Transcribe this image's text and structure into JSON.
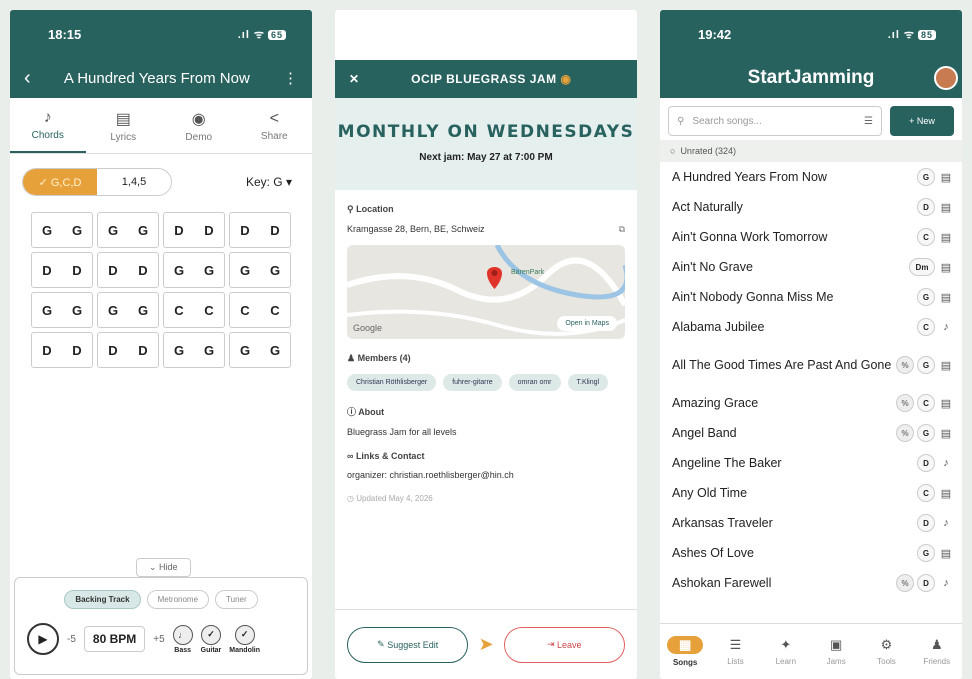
{
  "screen1": {
    "status": {
      "time": "18:15",
      "signal": ".ıl ᯤ",
      "battery": "65"
    },
    "header": {
      "back": "‹",
      "title": "A Hundred Years From Now",
      "menu": "⋮"
    },
    "tabs": [
      {
        "label": "Chords",
        "icon": "♪"
      },
      {
        "label": "Lyrics",
        "icon": "▤"
      },
      {
        "label": "Demo",
        "icon": "◉"
      },
      {
        "label": "Share",
        "icon": "<"
      }
    ],
    "segments": [
      "✓ G,C,D",
      "1,4,5"
    ],
    "key": "Key: G ▾",
    "chord_rows": [
      [
        [
          "G",
          "G"
        ],
        [
          "G",
          "G"
        ],
        [
          "D",
          "D"
        ],
        [
          "D",
          "D"
        ]
      ],
      [
        [
          "D",
          "D"
        ],
        [
          "D",
          "D"
        ],
        [
          "G",
          "G"
        ],
        [
          "G",
          "G"
        ]
      ],
      [
        [
          "G",
          "G"
        ],
        [
          "G",
          "G"
        ],
        [
          "C",
          "C"
        ],
        [
          "C",
          "C"
        ]
      ],
      [
        [
          "D",
          "D"
        ],
        [
          "D",
          "D"
        ],
        [
          "G",
          "G"
        ],
        [
          "G",
          "G"
        ]
      ]
    ],
    "hide": "⌄ Hide",
    "pills": [
      "Backing Track",
      "Metronome",
      "Tuner"
    ],
    "minus": "-5",
    "bpm": "80 BPM",
    "plus": "+5",
    "instruments": [
      "Bass",
      "Guitar",
      "Mandolin"
    ]
  },
  "screen2": {
    "header": {
      "close": "✕",
      "title": "OCIP BLUEGRASS JAM"
    },
    "banner_title": "MONTHLY ON WEDNESDAYS",
    "next_jam": "Next jam: May 27 at 7:00 PM",
    "location_label": "Location",
    "location": "Kramgasse 28, Bern, BE, Schweiz",
    "map_place": "BärenPark",
    "map_logo": "Google",
    "open_maps": "Open in Maps",
    "members_label": "Members (4)",
    "members": [
      "Christian Röthlisberger",
      "fuhrer-gitarre",
      "omran omr",
      "T.Klingl"
    ],
    "about_label": "About",
    "about": "Bluegrass Jam for all levels",
    "links_label": "Links & Contact",
    "links": "organizer: christian.roethlisberger@hin.ch",
    "updated": "Updated May 4, 2026",
    "suggest": "Suggest Edit",
    "leave": "Leave"
  },
  "screen3": {
    "status": {
      "time": "19:42",
      "signal": ".ıl ᯤ",
      "battery": "85"
    },
    "title": "StartJamming",
    "search_placeholder": "Search songs...",
    "new_label": "+ New",
    "unrated": "Unrated (324)",
    "songs": [
      {
        "name": "A Hundred Years From Now",
        "key": "G",
        "pct": false,
        "type": "lyrics"
      },
      {
        "name": "Act Naturally",
        "key": "D",
        "pct": false,
        "type": "lyrics"
      },
      {
        "name": "Ain't Gonna Work Tomorrow",
        "key": "C",
        "pct": false,
        "type": "lyrics"
      },
      {
        "name": "Ain't No Grave",
        "key": "Dm",
        "pct": false,
        "type": "lyrics"
      },
      {
        "name": "Ain't Nobody Gonna Miss Me",
        "key": "G",
        "pct": false,
        "type": "lyrics"
      },
      {
        "name": "Alabama Jubilee",
        "key": "C",
        "pct": false,
        "type": "tune"
      },
      {
        "name": "All The Good Times Are Past And Gone",
        "key": "G",
        "pct": true,
        "type": "lyrics"
      },
      {
        "name": "Amazing Grace",
        "key": "C",
        "pct": true,
        "type": "lyrics"
      },
      {
        "name": "Angel Band",
        "key": "G",
        "pct": true,
        "type": "lyrics"
      },
      {
        "name": "Angeline The Baker",
        "key": "D",
        "pct": false,
        "type": "tune"
      },
      {
        "name": "Any Old Time",
        "key": "C",
        "pct": false,
        "type": "lyrics"
      },
      {
        "name": "Arkansas Traveler",
        "key": "D",
        "pct": false,
        "type": "tune"
      },
      {
        "name": "Ashes Of Love",
        "key": "G",
        "pct": false,
        "type": "lyrics"
      },
      {
        "name": "Ashokan Farewell",
        "key": "D",
        "pct": true,
        "type": "tune"
      }
    ],
    "nav": [
      {
        "label": "Songs",
        "icon": "▦"
      },
      {
        "label": "Lists",
        "icon": "☰"
      },
      {
        "label": "Learn",
        "icon": "✦"
      },
      {
        "label": "Jams",
        "icon": "▣"
      },
      {
        "label": "Tools",
        "icon": "⚙"
      },
      {
        "label": "Friends",
        "icon": "♟"
      }
    ]
  }
}
